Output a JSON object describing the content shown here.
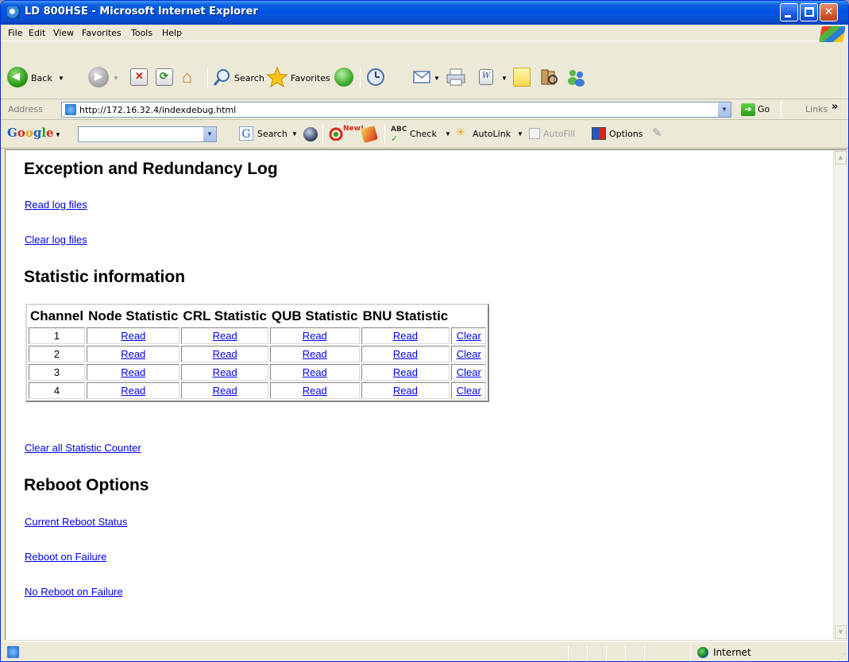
{
  "window": {
    "title": "LD 800HSE - Microsoft Internet Explorer"
  },
  "menu": [
    "File",
    "Edit",
    "View",
    "Favorites",
    "Tools",
    "Help"
  ],
  "toolbar": {
    "back_label": "Back",
    "search_label": "Search",
    "favorites_label": "Favorites"
  },
  "address": {
    "label": "Address",
    "url": "http://172.16.32.4/indexdebug.html",
    "go_label": "Go",
    "links_label": "Links"
  },
  "googlebar": {
    "logo": "Google",
    "search_label": "Search",
    "new_badge": "New!",
    "check_label": "Check",
    "autolink_label": "AutoLink",
    "autofill_label": "AutoFill",
    "options_label": "Options"
  },
  "page": {
    "section1_title": "Exception and Redundancy Log",
    "read_log": "Read log files",
    "clear_log": "Clear log files",
    "section2_title": "Statistic information",
    "table": {
      "headers": [
        "Channel",
        "Node Statistic",
        "CRL Statistic",
        "QUB Statistic",
        "BNU Statistic"
      ],
      "rows": [
        {
          "channel": "1",
          "node": "Read",
          "crl": "Read",
          "qub": "Read",
          "bnu": "Read",
          "clear": "Clear"
        },
        {
          "channel": "2",
          "node": "Read",
          "crl": "Read",
          "qub": "Read",
          "bnu": "Read",
          "clear": "Clear"
        },
        {
          "channel": "3",
          "node": "Read",
          "crl": "Read",
          "qub": "Read",
          "bnu": "Read",
          "clear": "Clear"
        },
        {
          "channel": "4",
          "node": "Read",
          "crl": "Read",
          "qub": "Read",
          "bnu": "Read",
          "clear": "Clear"
        }
      ]
    },
    "clear_all": "Clear all Statistic Counter",
    "section3_title": "Reboot Options",
    "current_reboot": "Current Reboot Status",
    "reboot_on_failure": "Reboot on Failure",
    "no_reboot_on_failure": "No Reboot on Failure"
  },
  "status": {
    "zone": "Internet"
  }
}
